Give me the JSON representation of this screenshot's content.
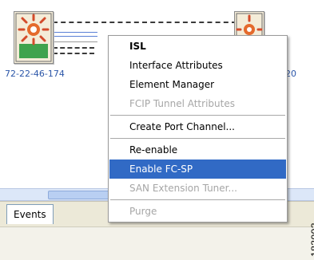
{
  "topology": {
    "left_switch_label": "72-22-46-174",
    "right_switch_label_partial": "20"
  },
  "tabs": {
    "events_label": "Events"
  },
  "figure_id": "183003",
  "context_menu": {
    "selected_index": 8,
    "items": [
      {
        "label": "ISL",
        "enabled": true,
        "bold": true
      },
      {
        "label": "Interface Attributes",
        "enabled": true
      },
      {
        "label": "Element Manager",
        "enabled": true
      },
      {
        "label": "FCIP Tunnel Attributes",
        "enabled": false
      },
      {
        "separator": true
      },
      {
        "label": "Create Port Channel...",
        "enabled": true
      },
      {
        "separator": true
      },
      {
        "label": "Re-enable",
        "enabled": true
      },
      {
        "label": "Enable FC-SP",
        "enabled": true
      },
      {
        "label": "SAN Extension Tuner...",
        "enabled": false
      },
      {
        "separator": true
      },
      {
        "label": "Purge",
        "enabled": false
      }
    ]
  },
  "colors": {
    "selection": "#316ac5",
    "disabled_text": "#a6a6a6",
    "node_label": "#2b56a8"
  }
}
